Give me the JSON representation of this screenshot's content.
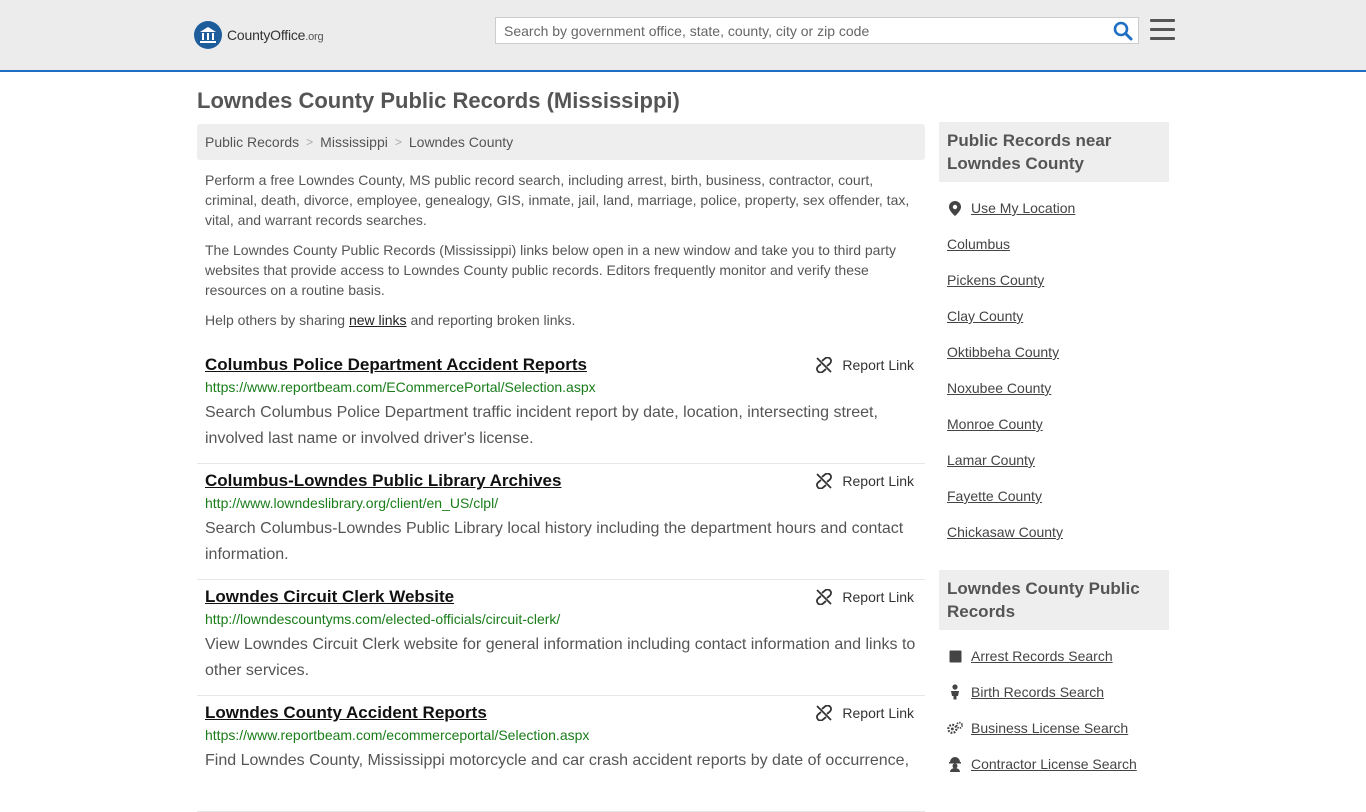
{
  "header": {
    "logo_text": "CountyOffice",
    "logo_tld": ".org",
    "search_placeholder": "Search by government office, state, county, city or zip code"
  },
  "page_title": "Lowndes County Public Records (Mississippi)",
  "breadcrumb": [
    "Public Records",
    "Mississippi",
    "Lowndes County"
  ],
  "intro": {
    "p1": "Perform a free Lowndes County, MS public record search, including arrest, birth, business, contractor, court, criminal, death, divorce, employee, genealogy, GIS, inmate, jail, land, marriage, police, property, sex offender, tax, vital, and warrant records searches.",
    "p2": "The Lowndes County Public Records (Mississippi) links below open in a new window and take you to third party websites that provide access to Lowndes County public records. Editors frequently monitor and verify these resources on a routine basis.",
    "p3_before": "Help others by sharing ",
    "p3_link": "new links",
    "p3_after": " and reporting broken links."
  },
  "report_label": "Report Link",
  "listings": [
    {
      "title": "Columbus Police Department Accident Reports",
      "url": "https://www.reportbeam.com/ECommercePortal/Selection.aspx",
      "desc": "Search Columbus Police Department traffic incident report by date, location, intersecting street, involved last name or involved driver's license."
    },
    {
      "title": "Columbus-Lowndes Public Library Archives",
      "url": "http://www.lowndeslibrary.org/client/en_US/clpl/",
      "desc": "Search Columbus-Lowndes Public Library local history including the department hours and contact information."
    },
    {
      "title": "Lowndes Circuit Clerk Website",
      "url": "http://lowndescountyms.com/elected-officials/circuit-clerk/",
      "desc": "View Lowndes Circuit Clerk website for general information including contact information and links to other services."
    },
    {
      "title": "Lowndes County Accident Reports",
      "url": "https://www.reportbeam.com/ecommerceportal/Selection.aspx",
      "desc": "Find Lowndes County, Mississippi motorcycle and car crash accident reports by date of occurrence,"
    }
  ],
  "sidebar": {
    "near_heading": "Public Records near Lowndes County",
    "use_location": "Use My Location",
    "near_items": [
      "Columbus",
      "Pickens County",
      "Clay County",
      "Oktibbeha County",
      "Noxubee County",
      "Monroe County",
      "Lamar County",
      "Fayette County",
      "Chickasaw County"
    ],
    "records_heading": "Lowndes County Public Records",
    "record_items": [
      {
        "label": "Arrest Records Search",
        "icon": "square-icon"
      },
      {
        "label": "Birth Records Search",
        "icon": "baby-icon"
      },
      {
        "label": "Business License Search",
        "icon": "gears-icon"
      },
      {
        "label": "Contractor License Search",
        "icon": "worker-icon"
      }
    ]
  },
  "colors": {
    "accent_blue": "#1e6fc3",
    "url_green": "#1a7d1a",
    "logo_blue": "#1d5d9b"
  }
}
